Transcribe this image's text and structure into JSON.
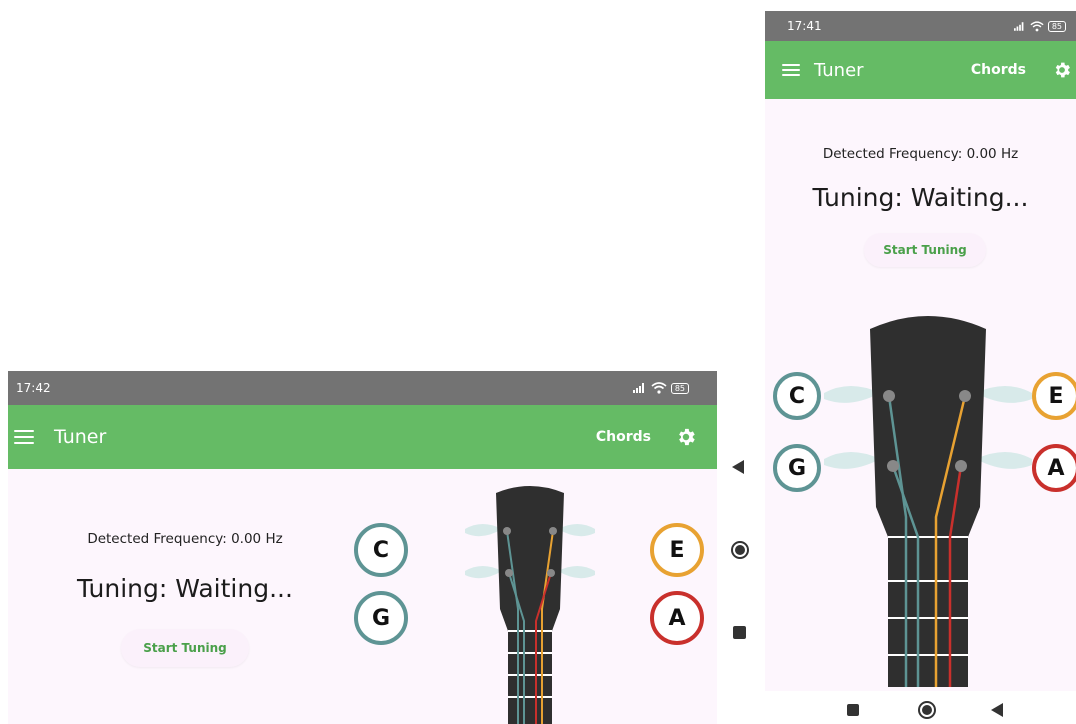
{
  "status": {
    "time_land": "17:42",
    "time_port": "17:41",
    "battery": "85"
  },
  "appbar": {
    "title": "Tuner",
    "chords_label": "Chords"
  },
  "main": {
    "frequency_text": "Detected Frequency: 0.00 Hz",
    "tuning_text": "Tuning: Waiting...",
    "start_label": "Start Tuning"
  },
  "strings": {
    "c": "C",
    "g": "G",
    "e": "E",
    "a": "A"
  },
  "icons": [
    "menu-icon",
    "gear-icon",
    "signal-icon",
    "wifi-icon",
    "battery-icon",
    "back-icon",
    "home-icon",
    "recents-icon"
  ],
  "colors": {
    "accent": "#65bb65",
    "teal": "#5e9494",
    "orange": "#e8a232",
    "red": "#c9302c",
    "headstock": "#2f2f2f"
  }
}
